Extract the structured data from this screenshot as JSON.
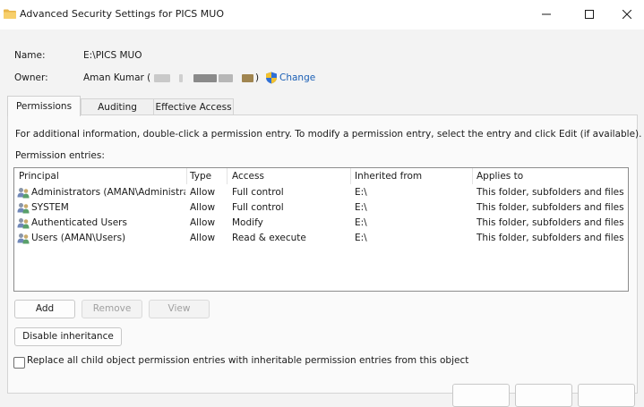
{
  "window": {
    "title": "Advanced Security Settings for PICS MUO"
  },
  "name_row": {
    "label": "Name:",
    "value": "E:\\PICS MUO"
  },
  "owner_row": {
    "label": "Owner:",
    "value": "Aman Kumar (",
    "close_paren": ")",
    "change_label": "Change"
  },
  "tabs": [
    {
      "label": "Permissions",
      "active": true
    },
    {
      "label": "Auditing",
      "active": false
    },
    {
      "label": "Effective Access",
      "active": false
    }
  ],
  "permissions": {
    "info_text": "For additional information, double-click a permission entry. To modify a permission entry, select the entry and click Edit (if available).",
    "entries_label": "Permission entries:",
    "columns": [
      "Principal",
      "Type",
      "Access",
      "Inherited from",
      "Applies to"
    ],
    "rows": [
      {
        "principal": "Administrators (AMAN\\Administra...",
        "type": "Allow",
        "access": "Full control",
        "inherited": "E:\\",
        "applies": "This folder, subfolders and files"
      },
      {
        "principal": "SYSTEM",
        "type": "Allow",
        "access": "Full control",
        "inherited": "E:\\",
        "applies": "This folder, subfolders and files"
      },
      {
        "principal": "Authenticated Users",
        "type": "Allow",
        "access": "Modify",
        "inherited": "E:\\",
        "applies": "This folder, subfolders and files"
      },
      {
        "principal": "Users (AMAN\\Users)",
        "type": "Allow",
        "access": "Read & execute",
        "inherited": "E:\\",
        "applies": "This folder, subfolders and files"
      }
    ],
    "buttons": {
      "add": "Add",
      "remove": "Remove",
      "view": "View",
      "disable_inheritance": "Disable inheritance"
    },
    "replace_checkbox_label": "Replace all child object permission entries with inheritable permission entries from this object"
  },
  "colors": {
    "link": "#1b5fb5",
    "folder": "#e8b54a",
    "shield_blue": "#2f6fd6",
    "shield_yellow": "#f2c12e"
  },
  "icons": {
    "window": "folder-icon",
    "owner": "uac-shield-icon",
    "principal": "user-group-icon"
  }
}
